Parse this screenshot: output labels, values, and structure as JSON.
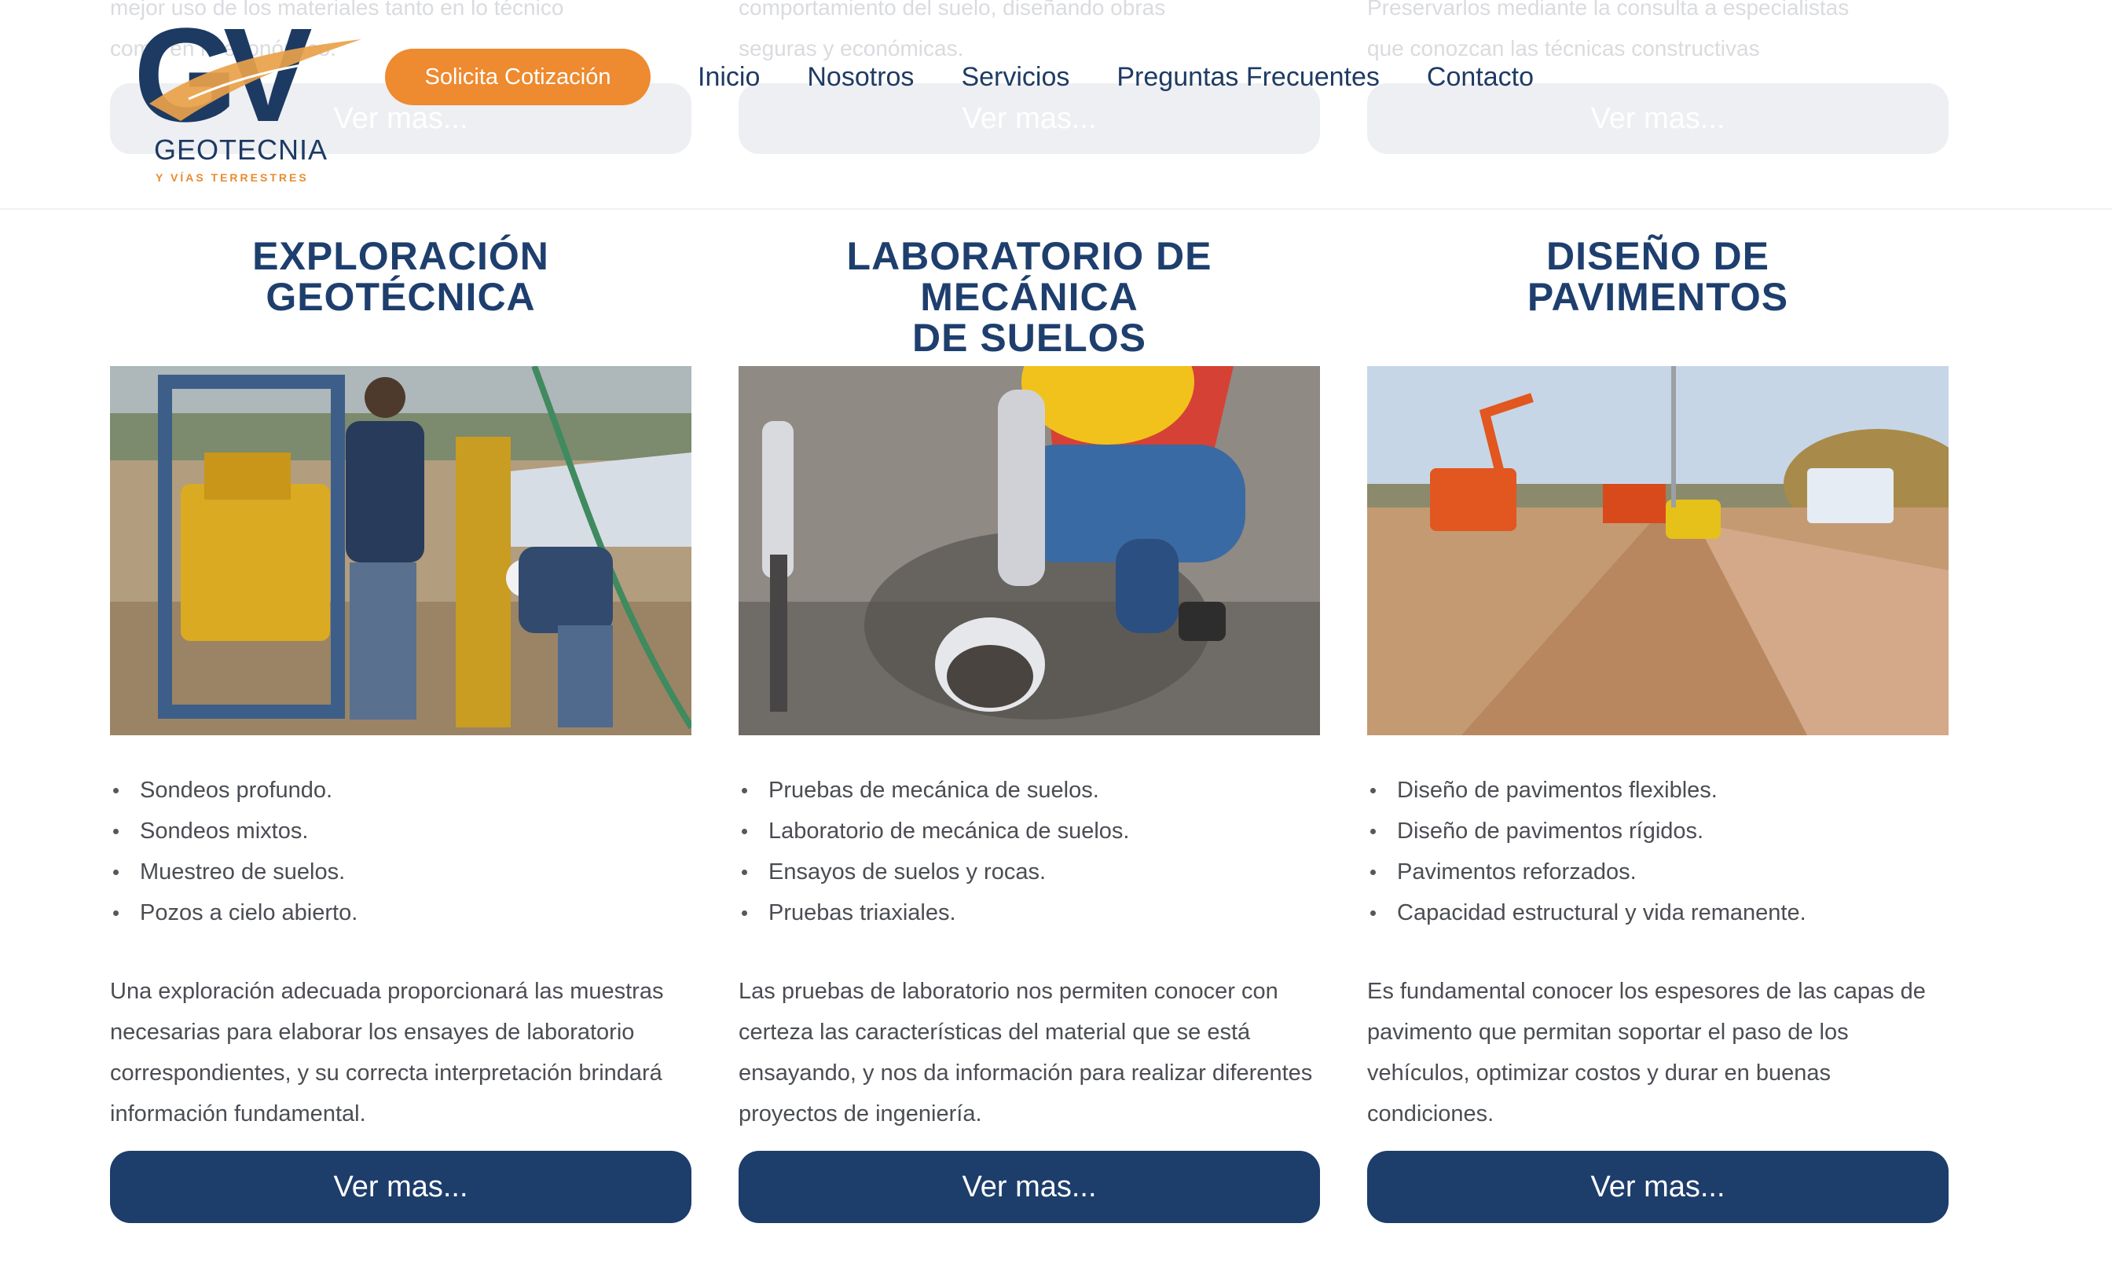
{
  "background_text": [
    {
      "lines": [
        "mejor uso de los materiales tanto en lo técnico",
        "como en lo económico."
      ],
      "button": "Ver mas..."
    },
    {
      "lines": [
        "comportamiento del suelo, diseñando obras",
        "seguras y económicas."
      ],
      "button": "Ver mas..."
    },
    {
      "lines": [
        "Preservarlos mediante la consulta a especialistas",
        "que conozcan las técnicas constructivas"
      ],
      "button": "Ver mas..."
    }
  ],
  "header": {
    "logo": {
      "mark": "GV",
      "name": "GEOTECNIA",
      "tagline": "Y VÍAS TERRESTRES"
    },
    "cta_label": "Solicita Cotización",
    "nav": [
      "Inicio",
      "Nosotros",
      "Servicios",
      "Preguntas Frecuentes",
      "Contacto"
    ]
  },
  "services": [
    {
      "title_lines": [
        "EXPLORACIÓN",
        "GEOTÉCNICA"
      ],
      "bullets": [
        "Sondeos profundo.",
        "Sondeos mixtos.",
        "Muestreo de suelos.",
        "Pozos a cielo abierto."
      ],
      "description": "Una exploración adecuada proporcionará las muestras necesarias para elaborar los ensayes de laboratorio correspondientes, y su correcta interpretación brindará información fundamental.",
      "button": "Ver mas..."
    },
    {
      "title_lines": [
        "LABORATORIO DE MECÁNICA",
        "DE SUELOS"
      ],
      "bullets": [
        "Pruebas de mecánica de suelos.",
        "Laboratorio de mecánica de suelos.",
        "Ensayos de suelos y rocas.",
        "Pruebas triaxiales."
      ],
      "description": "Las pruebas de laboratorio nos permiten conocer con certeza las características del material que se está ensayando, y nos da información para realizar diferentes proyectos de ingeniería.",
      "button": "Ver mas..."
    },
    {
      "title_lines": [
        "DISEÑO DE",
        "PAVIMENTOS"
      ],
      "bullets": [
        "Diseño de pavimentos flexibles.",
        "Diseño de pavimentos rígidos.",
        "Pavimentos reforzados.",
        "Capacidad estructural y vida remanente."
      ],
      "description": "Es fundamental conocer los espesores de las capas de pavimento que permitan soportar el paso de los vehículos, optimizar costos y durar en buenas condiciones.",
      "button": "Ver mas..."
    }
  ],
  "colors": {
    "brand_navy": "#1d3d6b",
    "title_blue": "#1e3f6e",
    "accent_orange": "#ee8a2f",
    "body_text": "#4a4d52"
  }
}
